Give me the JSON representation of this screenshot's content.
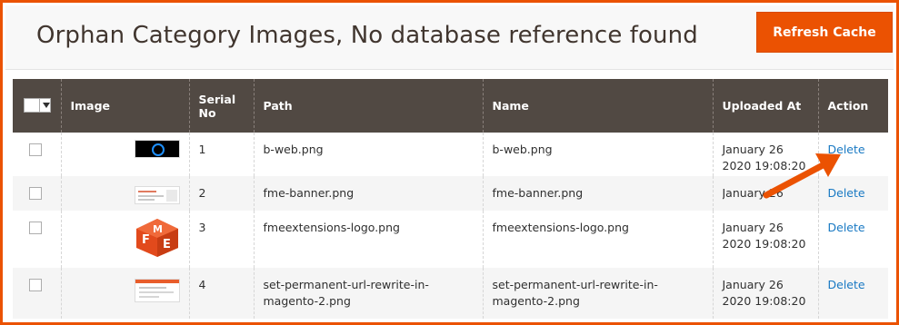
{
  "header": {
    "title": "Orphan Category Images, No database reference found",
    "refresh_label": "Refresh Cache"
  },
  "grid": {
    "columns": {
      "image": "Image",
      "serial": "Serial No",
      "path": "Path",
      "name": "Name",
      "uploaded": "Uploaded At",
      "action": "Action"
    },
    "rows": [
      {
        "serial": "1",
        "path": "b-web.png",
        "name": "b-web.png",
        "uploaded": "January 26 2020 19:08:20",
        "action": "Delete",
        "thumb": "b-web-thumbnail"
      },
      {
        "serial": "2",
        "path": "fme-banner.png",
        "name": "fme-banner.png",
        "uploaded": "January 26 2020 19:08:20",
        "action": "Delete",
        "thumb": "fme-banner-thumbnail"
      },
      {
        "serial": "3",
        "path": "fmeextensions-logo.png",
        "name": "fmeextensions-logo.png",
        "uploaded": "January 26 2020 19:08:20",
        "action": "Delete",
        "thumb": "fmeextensions-logo-thumbnail"
      },
      {
        "serial": "4",
        "path": "set-permanent-url-rewrite-in-magento-2.png",
        "name": "set-permanent-url-rewrite-in-magento-2.png",
        "uploaded": "January 26 2020 19:08:20",
        "action": "Delete",
        "thumb": "url-rewrite-thumbnail"
      }
    ]
  },
  "colors": {
    "accent": "#eb5202",
    "header_bg": "#514943",
    "link": "#1979c3",
    "annotation_arrow": "#eb5202"
  },
  "icons": {
    "mass_select": "chevron-down-icon",
    "annotation": "arrow-icon"
  }
}
